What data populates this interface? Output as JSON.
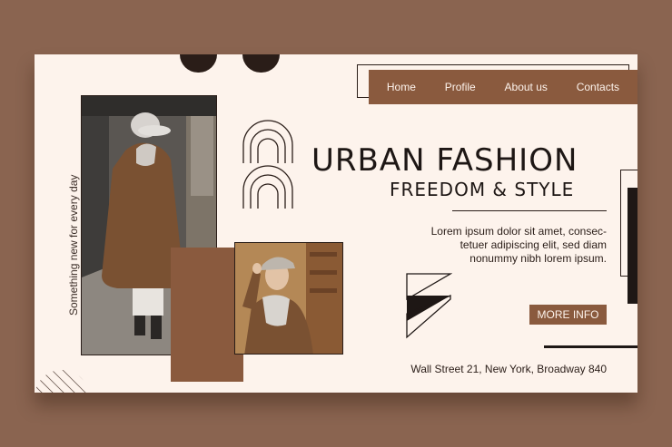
{
  "nav": {
    "items": [
      "Home",
      "Profile",
      "About us",
      "Contacts"
    ]
  },
  "hero": {
    "vertical_tagline": "Something new for every day",
    "title": "URBAN FASHION",
    "subtitle": "FREEDOM & STYLE",
    "description_lines": [
      "Lorem ipsum dolor sit amet, consec-",
      "tetuer adipiscing elit, sed diam",
      "nonummy nibh lorem ipsum."
    ],
    "cta_label": "MORE INFO",
    "address": "Wall Street 21, New York, Broadway 840"
  },
  "colors": {
    "background": "#8a6450",
    "card": "#fdf3ec",
    "accent_brown": "#8a5a3e",
    "dark": "#1e1715"
  },
  "icons": {
    "arches": "arch-lines-icon",
    "triangles": "triangle-blocks-icon",
    "stripes": "striped-circle-icon"
  }
}
